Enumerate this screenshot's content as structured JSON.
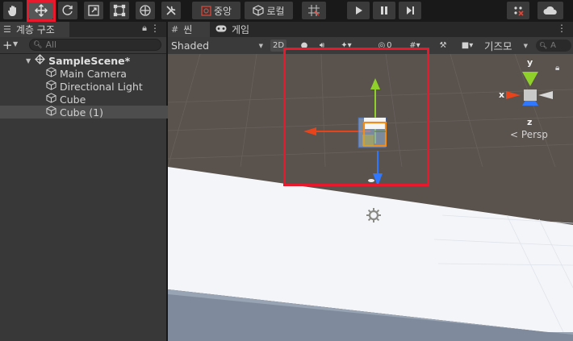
{
  "toolbar": {
    "tools": [
      "hand-tool",
      "move-tool",
      "rotate-tool",
      "scale-tool",
      "rect-tool",
      "transform-tool",
      "custom-tool"
    ],
    "active_tool": "move-tool",
    "pivot_label": "중앙",
    "space_label": "로컬",
    "playback": [
      "play",
      "pause",
      "step"
    ]
  },
  "hierarchy": {
    "tab_label": "계층 구조",
    "search_placeholder": "All",
    "scene_name": "SampleScene*",
    "items": [
      {
        "label": "Main Camera",
        "selected": false
      },
      {
        "label": "Directional Light",
        "selected": false
      },
      {
        "label": "Cube",
        "selected": false
      },
      {
        "label": "Cube (1)",
        "selected": true
      }
    ]
  },
  "scene_view": {
    "tabs": [
      {
        "label": "씬",
        "active": true
      },
      {
        "label": "게임",
        "active": false
      }
    ],
    "shading_mode": "Shaded",
    "toggle_2d": "2D",
    "hidden_count": "0",
    "gizmos_label": "기즈모",
    "search_placeholder": "A",
    "projection_label": "Persp",
    "axis_labels": {
      "x": "x",
      "y": "y",
      "z": "z"
    }
  },
  "colors": {
    "x_axis": "#e8441c",
    "y_axis": "#8fd12a",
    "z_axis": "#2f78ff",
    "highlight": "#e8192c",
    "selection_outline": "#f28b18"
  }
}
